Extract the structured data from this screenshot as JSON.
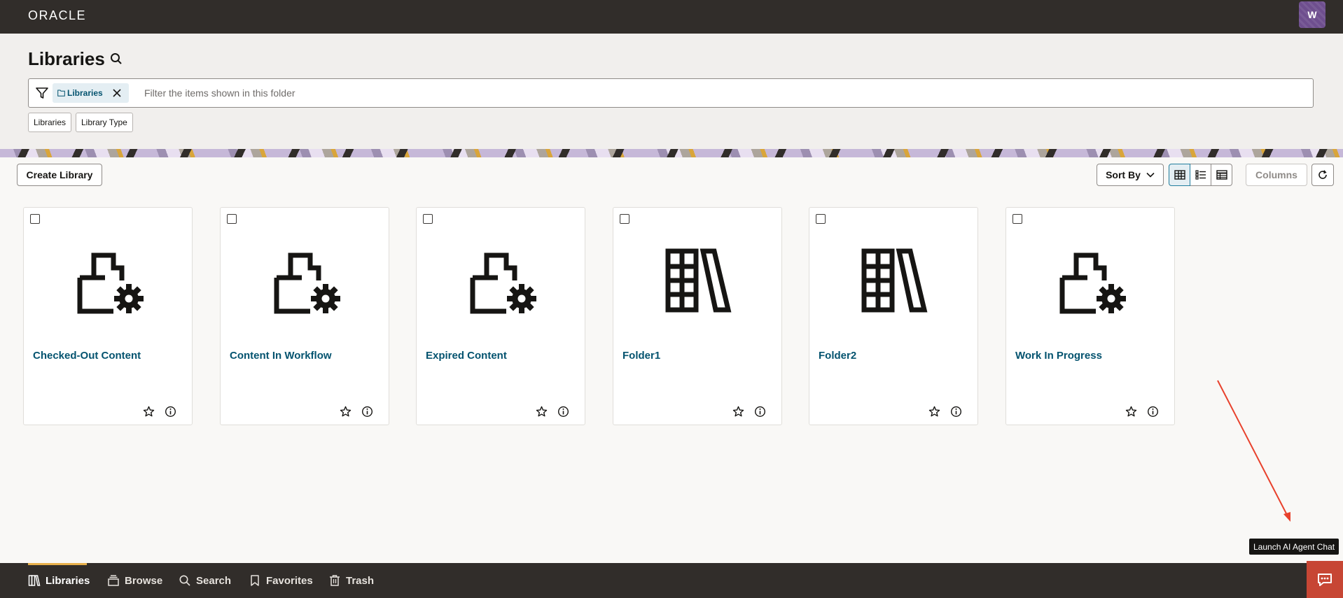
{
  "topbar": {
    "logo": "ORACLE",
    "avatar_initial": "W"
  },
  "header": {
    "title": "Libraries",
    "filter_chip_label": "Libraries",
    "filter_placeholder": "Filter the items shown in this folder",
    "facets": [
      "Libraries",
      "Library Type"
    ]
  },
  "toolbar": {
    "create_label": "Create Library",
    "sort_label": "Sort By",
    "columns_label": "Columns"
  },
  "cards": [
    {
      "title": "Checked-Out Content",
      "icon": "folder-gear-icon"
    },
    {
      "title": "Content In Workflow",
      "icon": "folder-gear-icon"
    },
    {
      "title": "Expired Content",
      "icon": "folder-gear-icon"
    },
    {
      "title": "Folder1",
      "icon": "library-books-icon"
    },
    {
      "title": "Folder2",
      "icon": "library-books-icon"
    },
    {
      "title": "Work In Progress",
      "icon": "folder-gear-icon"
    }
  ],
  "tooltip": "Launch AI Agent Chat",
  "bottom_nav": [
    {
      "label": "Libraries",
      "active": true
    },
    {
      "label": "Browse",
      "active": false
    },
    {
      "label": "Search",
      "active": false
    },
    {
      "label": "Favorites",
      "active": false
    },
    {
      "label": "Trash",
      "active": false
    }
  ],
  "colors": {
    "topbar": "#312d2a",
    "link": "#04536f",
    "accent": "#e8b14c",
    "chat": "#c74634"
  }
}
